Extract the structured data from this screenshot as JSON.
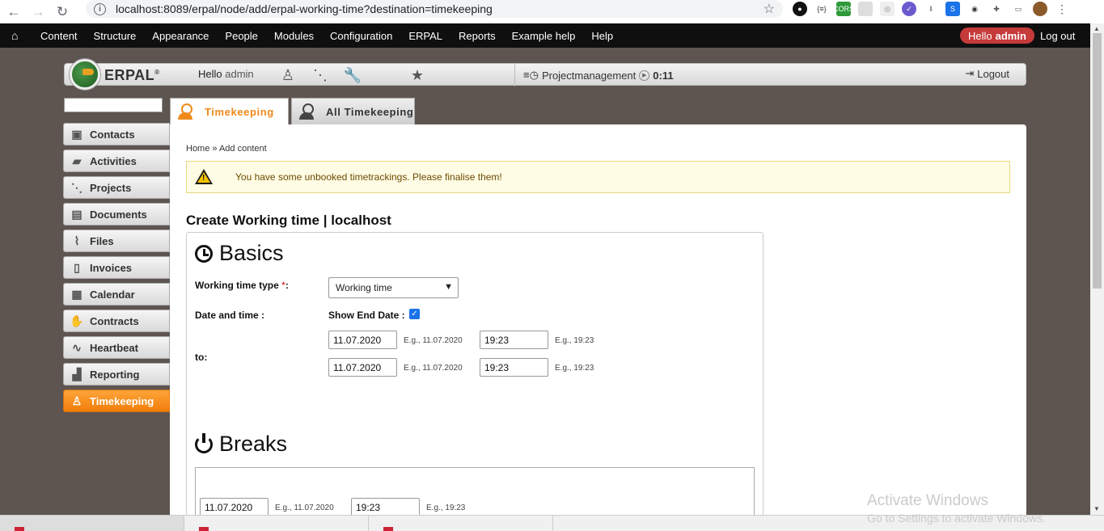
{
  "browser": {
    "url": "localhost:8089/erpal/node/add/erpal-working-time?destination=timekeeping"
  },
  "admin_toolbar": {
    "items": [
      "Content",
      "Structure",
      "Appearance",
      "People",
      "Modules",
      "Configuration",
      "ERPAL",
      "Reports",
      "Example help",
      "Help"
    ],
    "hello": "Hello",
    "user": "admin",
    "logout": "Log out"
  },
  "erpal_bar": {
    "logo": "ERPAL",
    "hello": "Hello",
    "user": "admin",
    "project": "Projectmanagement",
    "timer": "0:11",
    "logout": "Logout"
  },
  "tabs": [
    {
      "label": "Timekeeping"
    },
    {
      "label": "All Timekeeping"
    }
  ],
  "sidebar": {
    "items": [
      {
        "label": "Contacts",
        "icon": "contacts-icon"
      },
      {
        "label": "Activities",
        "icon": "activities-icon"
      },
      {
        "label": "Projects",
        "icon": "projects-icon"
      },
      {
        "label": "Documents",
        "icon": "documents-icon"
      },
      {
        "label": "Files",
        "icon": "paperclip-icon"
      },
      {
        "label": "Invoices",
        "icon": "invoice-icon"
      },
      {
        "label": "Calendar",
        "icon": "calendar-icon"
      },
      {
        "label": "Contracts",
        "icon": "handshake-icon"
      },
      {
        "label": "Heartbeat",
        "icon": "heartbeat-icon"
      },
      {
        "label": "Reporting",
        "icon": "chart-icon"
      },
      {
        "label": "Timekeeping",
        "icon": "user-icon",
        "active": true
      }
    ]
  },
  "main": {
    "breadcrumb": "Home » Add content",
    "warning": "You have some unbooked timetrackings. Please finalise them!",
    "title": "Create Working time | localhost",
    "basics": {
      "heading": "Basics",
      "type_label": "Working time type",
      "type_req": "*",
      "type_colon": ":",
      "type_value": "Working time",
      "date_label": "Date and time :",
      "show_end_label": "Show End Date :",
      "show_end_checked": true,
      "to_label": "to:",
      "start_date": "11.07.2020",
      "start_time": "19:23",
      "end_date": "11.07.2020",
      "end_time": "19:23",
      "date_hint": "E.g., 11.07.2020",
      "time_hint": "E.g., 19:23"
    },
    "breaks": {
      "heading": "Breaks",
      "date": "11.07.2020",
      "time": "19:23",
      "date_hint": "E.g., 11.07.2020",
      "time_hint": "E.g., 19:23"
    }
  },
  "watermark": {
    "line1": "Activate Windows",
    "line2": "Go to Settings to activate Windows."
  }
}
